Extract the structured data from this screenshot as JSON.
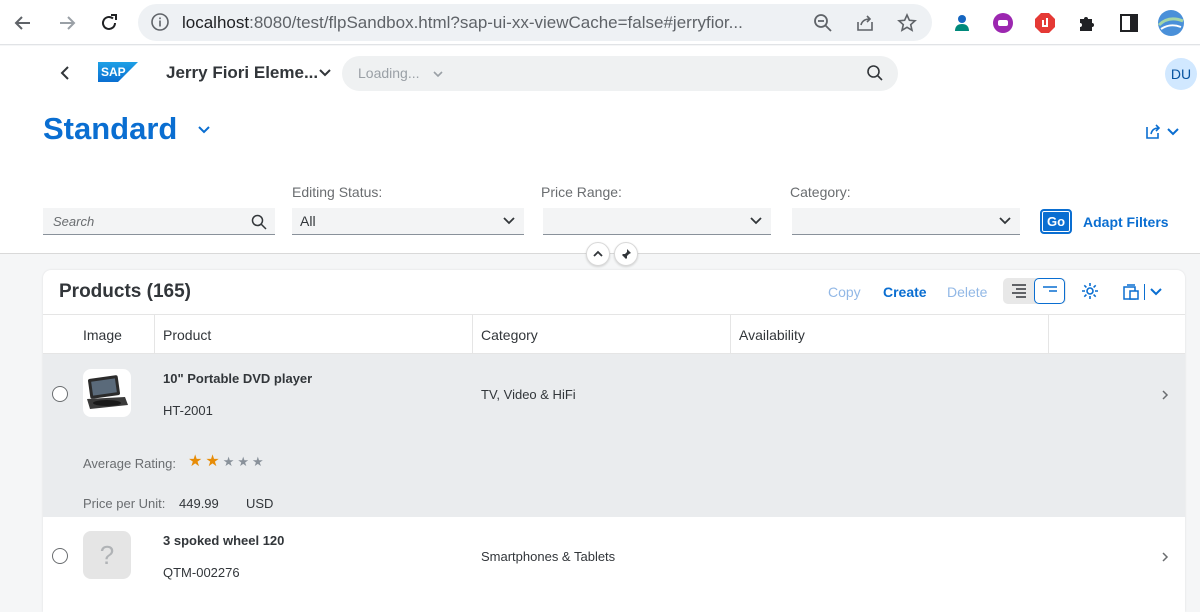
{
  "browser": {
    "url_host": "localhost",
    "url_rest": ":8080/test/flpSandbox.html?sap-ui-xx-viewCache=false#jerryfior..."
  },
  "shell": {
    "app_title": "Jerry Fiori Eleme...",
    "search_placeholder": "Loading...",
    "avatar_initials": "DU",
    "logo_text": "SAP"
  },
  "header": {
    "variant_title": "Standard"
  },
  "filters": {
    "search_placeholder": "Search",
    "editing_status_label": "Editing Status:",
    "editing_status_value": "All",
    "price_range_label": "Price Range:",
    "price_range_value": "",
    "category_label": "Category:",
    "category_value": "",
    "go_label": "Go",
    "adapt_label": "Adapt Filters"
  },
  "table": {
    "title": "Products (165)",
    "copy_label": "Copy",
    "create_label": "Create",
    "delete_label": "Delete",
    "columns": [
      "Image",
      "Product",
      "Category",
      "Availability"
    ],
    "rows": [
      {
        "name": "10\" Portable DVD player",
        "id": "HT-2001",
        "category": "TV, Video & HiFi",
        "availability": "",
        "rating_label": "Average Rating:",
        "rating_value": 2,
        "rating_max": 5,
        "price_label": "Price per Unit:",
        "price": "449.99",
        "currency": "USD"
      },
      {
        "name": "3 spoked wheel 120",
        "id": "QTM-002276",
        "category": "Smartphones & Tablets",
        "availability": "",
        "placeholder_glyph": "?"
      }
    ]
  },
  "colors": {
    "brand_blue": "#0a6ed1",
    "star_filled": "#e78c07",
    "star_empty": "#89919a",
    "selected_row": "#eaecee"
  }
}
